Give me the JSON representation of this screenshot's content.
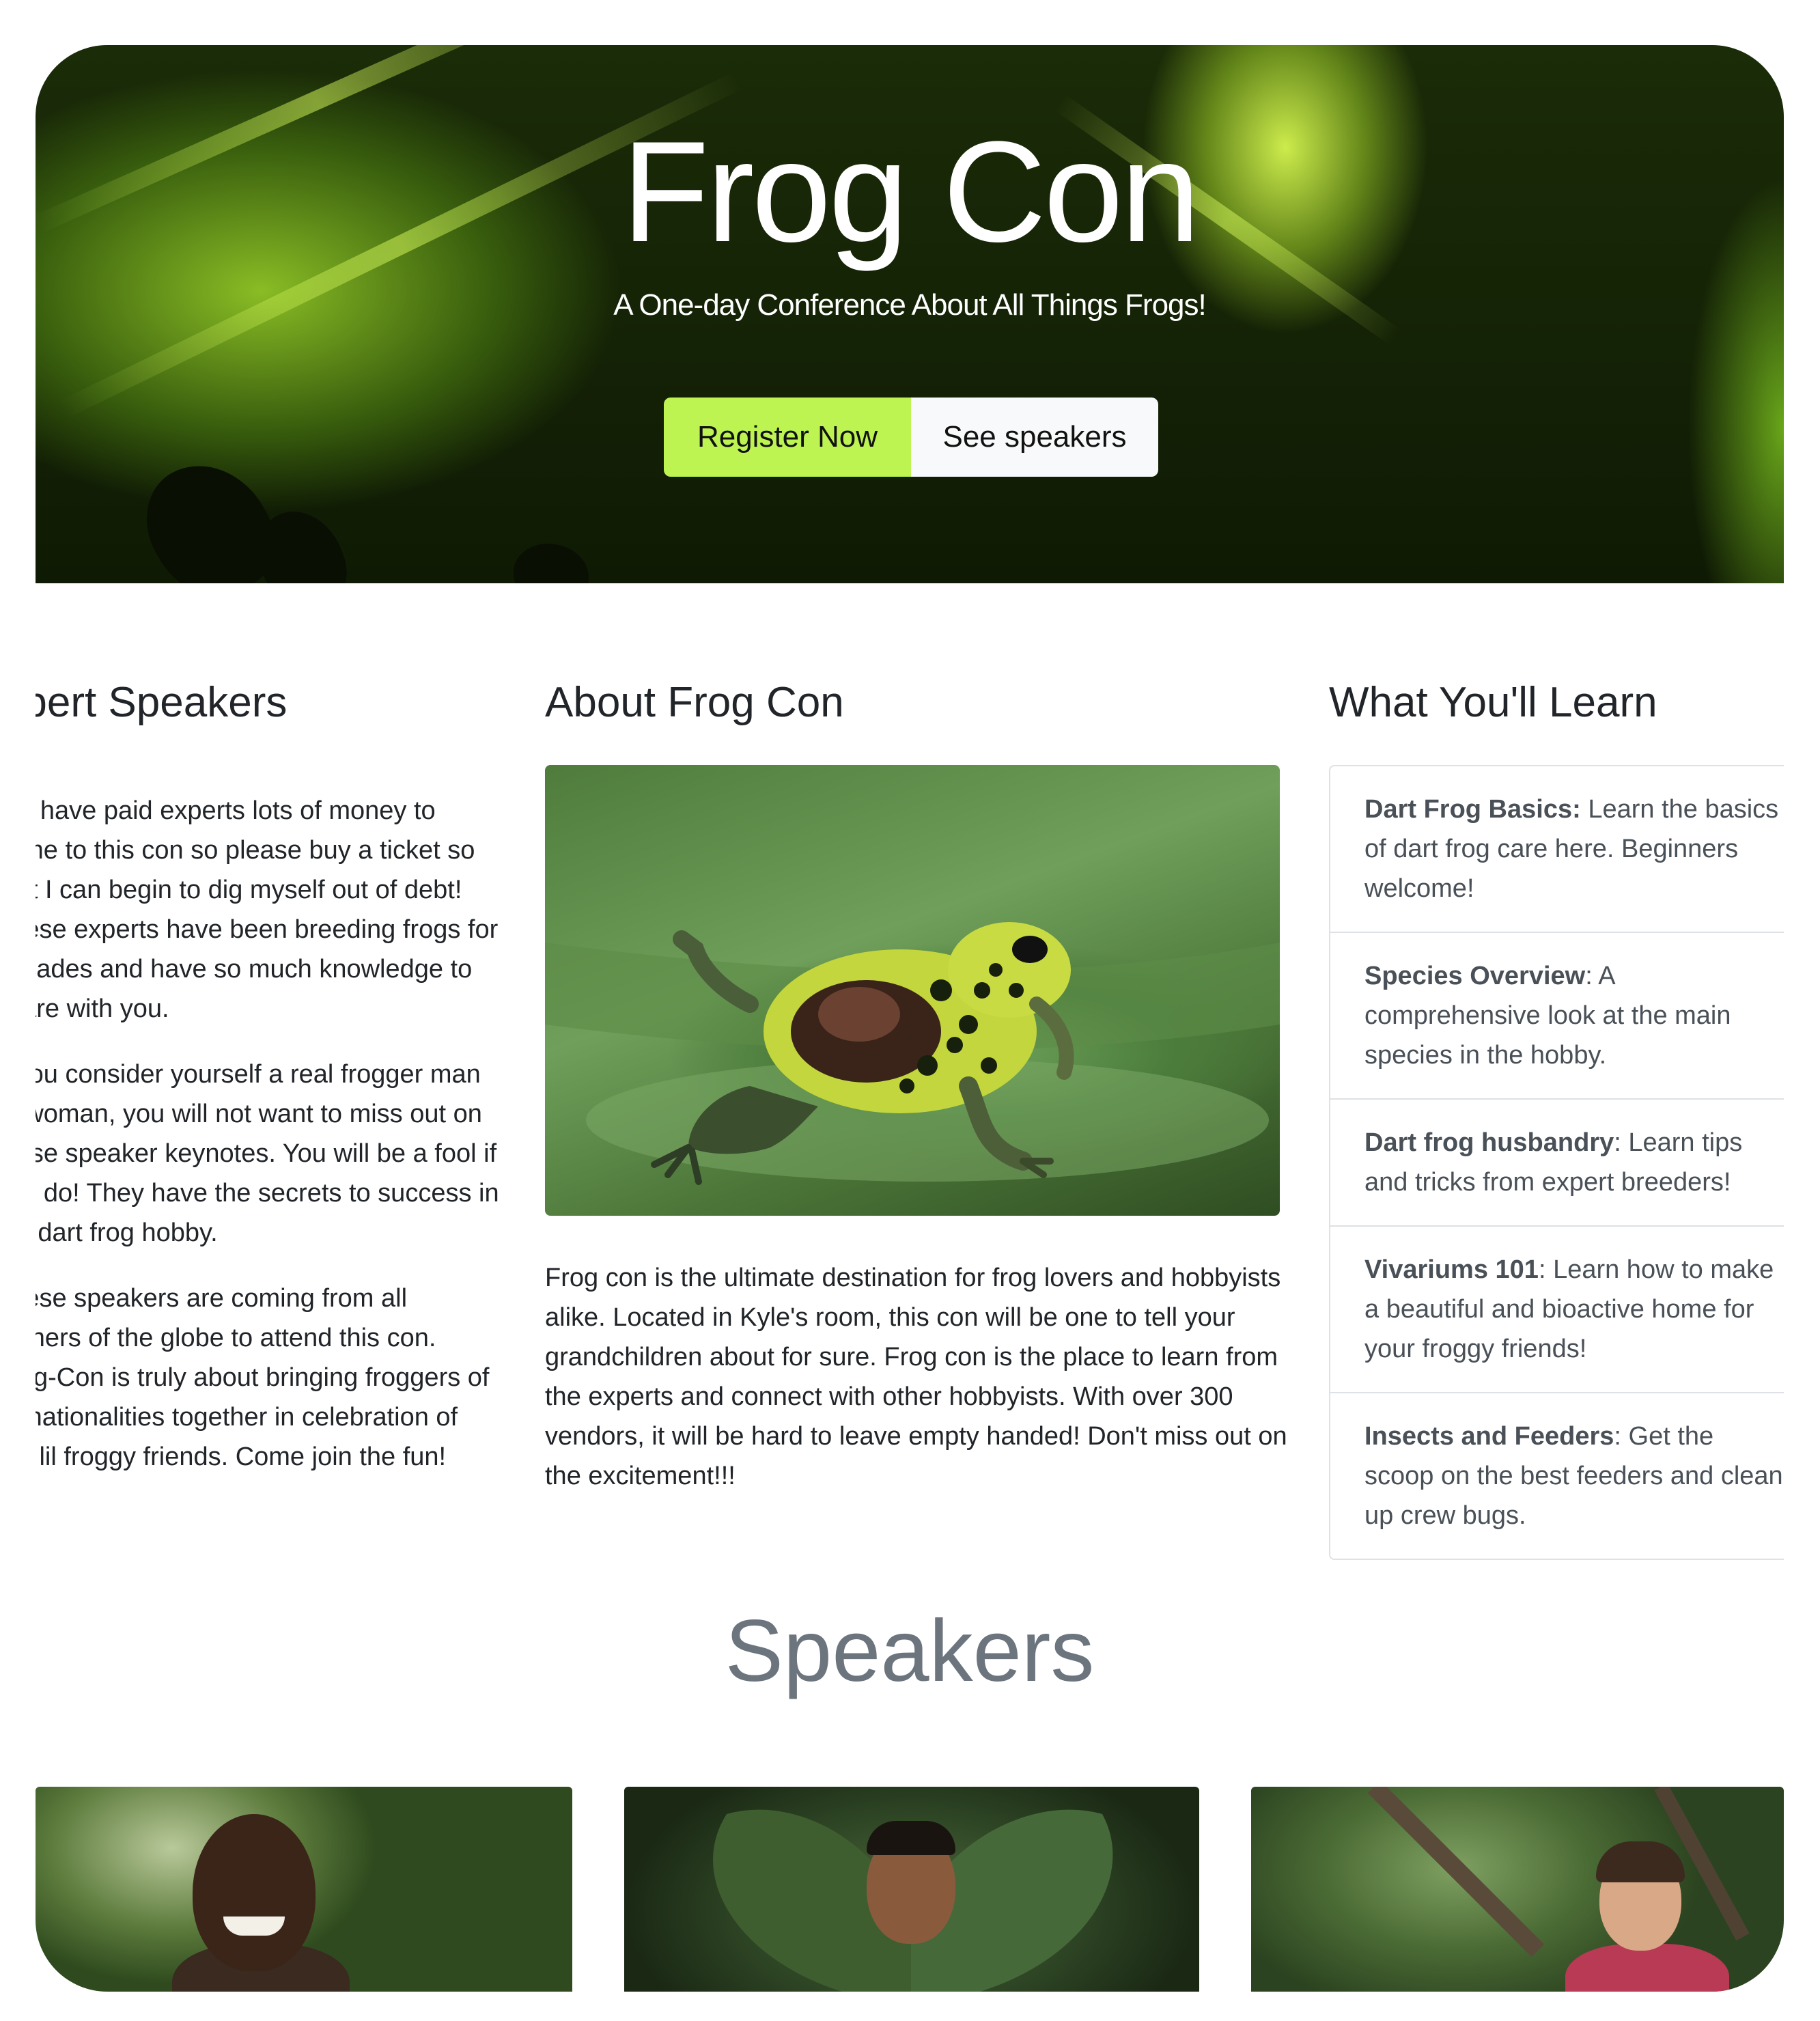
{
  "hero": {
    "title": "Frog Con",
    "subtitle": "A One-day Conference About All Things Frogs!",
    "register_label": "Register Now",
    "speakers_label": "See speakers",
    "accent_color": "#bdf452"
  },
  "experts": {
    "title": "Expert Speakers",
    "paragraphs": [
      "We have paid experts lots of money to come to this con so please buy a ticket so that I can begin to dig myself out of debt! These experts have been breeding frogs for decades and have so much knowledge to share with you.",
      "If you consider yourself a real frogger man or woman, you will not want to miss out on these speaker keynotes. You will be a fool if you do! They have the secrets to success in the dart frog hobby.",
      "These speakers are coming from all corners of the globe to attend this con. Frog-Con is truly about bringing froggers of all nationalities together in celebration of our lil froggy friends. Come join the fun!"
    ]
  },
  "about": {
    "title": "About Frog Con",
    "image_alt": "poison dart frog on a leaf",
    "text": "Frog con is the ultimate destination for frog lovers and hobbyists alike. Located in Kyle's room, this con will be one to tell your grandchildren about for sure. Frog con is the place to learn from the experts and connect with other hobbyists. With over 300 vendors, it will be hard to leave empty handed! Don't miss out on the excitement!!!"
  },
  "learn": {
    "title": "What You'll Learn",
    "items": [
      {
        "name": "Dart Frog Basics",
        "desc": "Learn the basics of dart frog care here. Beginners welcome!"
      },
      {
        "name": "Species Overview",
        "desc": "A comprehensive look at the main species in the hobby."
      },
      {
        "name": "Dart frog husbandry",
        "desc": "Learn tips and tricks from expert breeders!"
      },
      {
        "name": "Vivariums 101",
        "desc": "Learn how to make a beautiful and bioactive home for your froggy friends!"
      },
      {
        "name": "Insects and Feeders",
        "desc": "Get the scoop on the best feeders and clean up crew bugs."
      }
    ]
  },
  "speakers": {
    "title": "Speakers"
  }
}
